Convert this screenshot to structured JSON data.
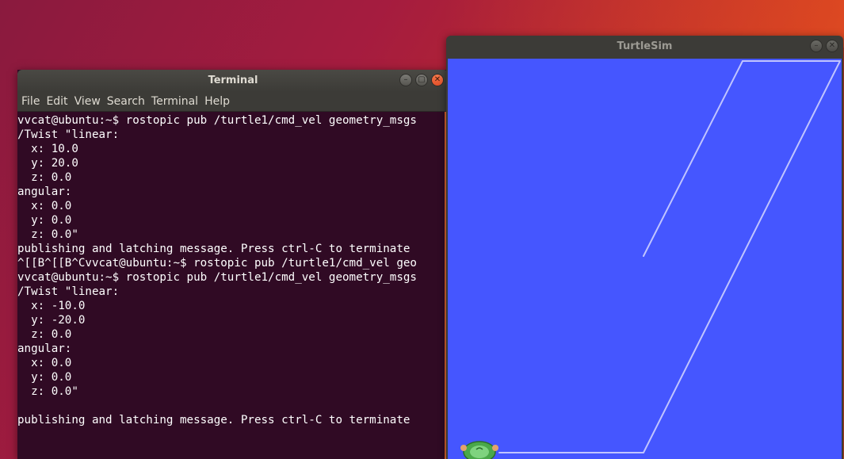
{
  "terminal": {
    "title": "Terminal",
    "menu": [
      "File",
      "Edit",
      "View",
      "Search",
      "Terminal",
      "Help"
    ],
    "lines": [
      "vvcat@ubuntu:~$ rostopic pub /turtle1/cmd_vel geometry_msgs",
      "/Twist \"linear:",
      "  x: 10.0",
      "  y: 20.0",
      "  z: 0.0",
      "angular:",
      "  x: 0.0",
      "  y: 0.0",
      "  z: 0.0\"",
      "publishing and latching message. Press ctrl-C to terminate",
      "^[[B^[[B^Cvvcat@ubuntu:~$ rostopic pub /turtle1/cmd_vel geo",
      "vvcat@ubuntu:~$ rostopic pub /turtle1/cmd_vel geometry_msgs",
      "/Twist \"linear:",
      "  x: -10.0",
      "  y: -20.0",
      "  z: 0.0",
      "angular:",
      "  x: 0.0",
      "  y: 0.0",
      "  z: 0.0\"",
      "",
      "publishing and latching message. Press ctrl-C to terminate"
    ]
  },
  "turtlesim": {
    "title": "TurtleSim",
    "background_color": "#4556ff",
    "pen_color": "#b3b8ff"
  }
}
